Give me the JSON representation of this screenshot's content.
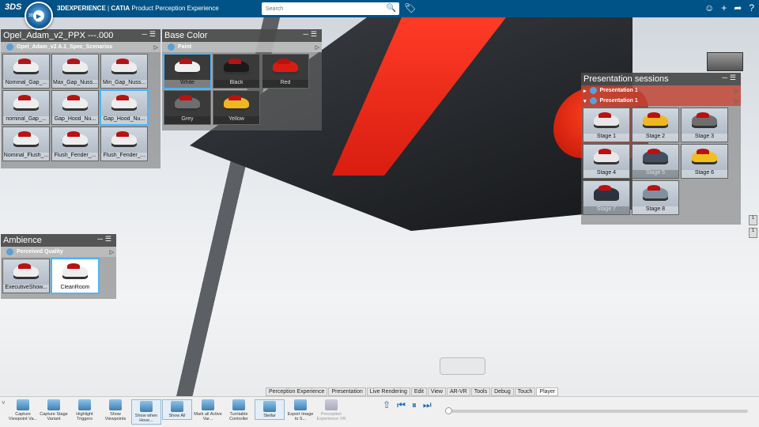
{
  "header": {
    "logo": "3DS",
    "compass": {
      "label_3d": "3D",
      "label_vr": "V.R"
    },
    "brand": "3DEXPERIENCE",
    "separator": " | ",
    "app": "CATIA",
    "product": "Product Perception Experience",
    "search_placeholder": "Search",
    "icons": [
      "user-icon",
      "plus-icon",
      "share-icon",
      "help-icon"
    ]
  },
  "scenarios_panel": {
    "title": "Opel_Adam_v2_PPX ---.000",
    "subtitle": "Opel_Adam_v2 A.1_Spec_Scenarios",
    "items": [
      {
        "label": "Nominal_Gap_..."
      },
      {
        "label": "Max_Gap_Nuss..."
      },
      {
        "label": "Min_Gap_Nuss..."
      },
      {
        "label": "nominal_Gap_..."
      },
      {
        "label": "Gap_Hood_Nu..."
      },
      {
        "label": "Gap_Hood_Nu..."
      },
      {
        "label": "Nominal_Flush_..."
      },
      {
        "label": "Flush_Fender_..."
      },
      {
        "label": "Flush_Fender_..."
      }
    ]
  },
  "base_color_panel": {
    "title": "Base Color",
    "subtitle": "Paint",
    "items": [
      {
        "label": "White",
        "color": "#f0f0f0"
      },
      {
        "label": "Black",
        "color": "#1a1a1a"
      },
      {
        "label": "Red",
        "color": "#d81d10"
      },
      {
        "label": "Grey",
        "color": "#6e6e6e"
      },
      {
        "label": "Yellow",
        "color": "#f0b820"
      }
    ]
  },
  "ambience_panel": {
    "title": "Ambience",
    "subtitle": "Perceived Quality",
    "items": [
      {
        "label": "ExecutiveShow..."
      },
      {
        "label": "CleanRoom"
      }
    ]
  },
  "sessions_panel": {
    "title": "Presentation sessions",
    "rows": [
      {
        "label": "Presentation 1"
      },
      {
        "label": "Presentation 1"
      }
    ],
    "stages": [
      {
        "label": "Stage 1",
        "color": "#e8e8e8"
      },
      {
        "label": "Stage 2",
        "color": "#f0b820"
      },
      {
        "label": "Stage 3",
        "color": "#6e6e6e"
      },
      {
        "label": "Stage 4",
        "color": "#e8e8e8"
      },
      {
        "label": "Stage 5",
        "color": "#405060"
      },
      {
        "label": "Stage 6",
        "color": "#f0c020"
      },
      {
        "label": "Stage 7",
        "color": "#2a3440"
      },
      {
        "label": "Stage 8",
        "color": "#8090a0"
      }
    ]
  },
  "tabs": [
    "Perception Experience",
    "Presentation",
    "Live Rendering",
    "Edit",
    "View",
    "AR-VR",
    "Tools",
    "Debug",
    "Touch",
    "Player"
  ],
  "active_tab": "Player",
  "toolbar": {
    "tools": [
      {
        "label": "Capture Viewpoint Va..."
      },
      {
        "label": "Capture Stage Variant"
      },
      {
        "label": "Highlight Triggers"
      },
      {
        "label": "Show Viewpoints"
      },
      {
        "label": "Show when Hove..."
      },
      {
        "label": "Show All"
      },
      {
        "label": "Mark all Active Var..."
      },
      {
        "label": "Turntable Controller"
      },
      {
        "label": "Stellar"
      },
      {
        "label": "Export Image to S..."
      },
      {
        "label": "Perception Experience VR"
      }
    ]
  },
  "side_buttons": [
    "1",
    "1"
  ]
}
